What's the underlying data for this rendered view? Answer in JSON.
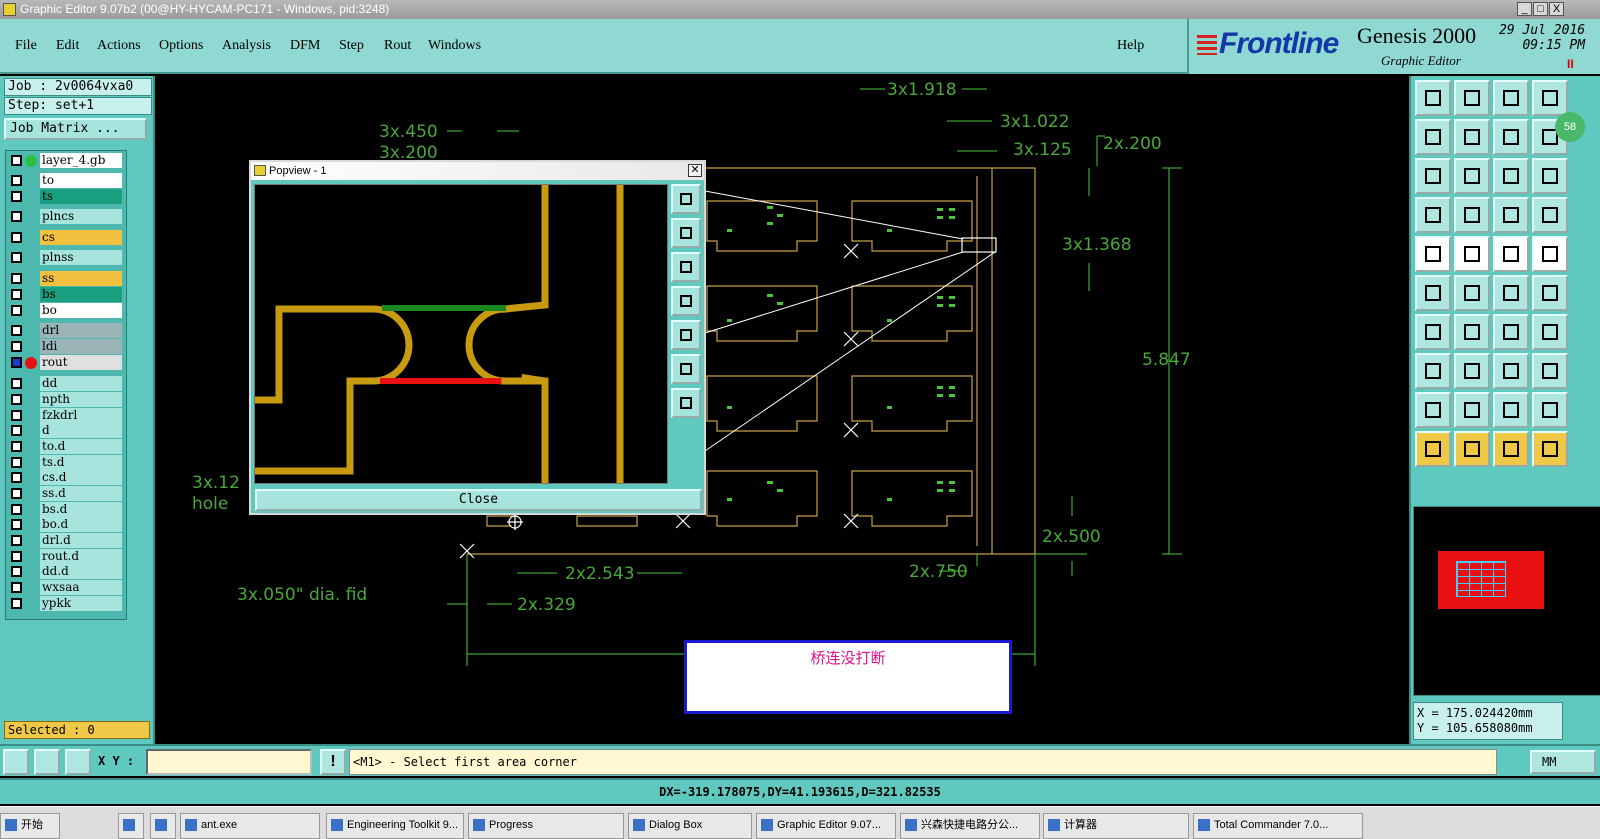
{
  "window": {
    "title": "Graphic Editor 9.07b2 (00@HY-HYCAM-PC171 - Windows, pid:3248)",
    "min": "_",
    "max": "□",
    "close": "X"
  },
  "menu": [
    "File",
    "Edit",
    "Actions",
    "Options",
    "Analysis",
    "DFM",
    "Step",
    "Rout",
    "Windows"
  ],
  "help": "Help",
  "logo": {
    "brand": "Frontline",
    "product": "Genesis 2000",
    "subtitle": "Graphic Editor",
    "date": "29 Jul 2016",
    "time": "09:15 PM",
    "pause": "II"
  },
  "job": {
    "job": "Job : 2v0064vxa0",
    "step": "Step: set+1",
    "matrix_button": "Job Matrix ..."
  },
  "layers": [
    {
      "name": "layer_4.gb",
      "color": "#ffffff",
      "dot": "#2cc040"
    },
    {
      "name": "to",
      "color": "#ffffff"
    },
    {
      "name": "ts",
      "color": "#1aa080"
    },
    {
      "name": "plncs",
      "color": "#a8e4de"
    },
    {
      "name": "cs",
      "color": "#f4c040"
    },
    {
      "name": "plnss",
      "color": "#a8e4de"
    },
    {
      "name": "ss",
      "color": "#f4c040"
    },
    {
      "name": "bs",
      "color": "#1aa080"
    },
    {
      "name": "bo",
      "color": "#ffffff"
    },
    {
      "name": "drl",
      "color": "#9ab4b8"
    },
    {
      "name": "ldi",
      "color": "#9ab4b8"
    },
    {
      "name": "rout",
      "color": "#e0e0e0",
      "dot": "#e81010",
      "active": true
    },
    {
      "name": "dd",
      "color": "#a8e4de"
    },
    {
      "name": "npth",
      "color": "#a8e4de"
    },
    {
      "name": "fzkdrl",
      "color": "#a8e4de"
    },
    {
      "name": "d",
      "color": "#a8e4de"
    },
    {
      "name": "to.d",
      "color": "#a8e4de"
    },
    {
      "name": "ts.d",
      "color": "#a8e4de"
    },
    {
      "name": "cs.d",
      "color": "#a8e4de"
    },
    {
      "name": "ss.d",
      "color": "#a8e4de"
    },
    {
      "name": "bs.d",
      "color": "#a8e4de"
    },
    {
      "name": "bo.d",
      "color": "#a8e4de"
    },
    {
      "name": "drl.d",
      "color": "#a8e4de"
    },
    {
      "name": "rout.d",
      "color": "#a8e4de"
    },
    {
      "name": "dd.d",
      "color": "#a8e4de"
    },
    {
      "name": "wxsaa",
      "color": "#a8e4de"
    },
    {
      "name": "ypkk",
      "color": "#a8e4de"
    }
  ],
  "selected": "Selected : 0",
  "dimensions": [
    "3x1.918",
    "3x.450",
    "3x.200",
    "3x1.022",
    "3x.125",
    "2x.200",
    "3x1.368",
    "5.847",
    "3x.12",
    "hole",
    "2x.500",
    "2x2.543",
    "2x.750",
    "3x.050\" dia. fid",
    "2x.329"
  ],
  "popview": {
    "title": "Popview - 1",
    "close_label": "Close"
  },
  "note": "桥连没打断",
  "coords": {
    "x": "X  =  175.024420mm",
    "y": "Y  =  105.658080mm"
  },
  "badge": "58",
  "bottom": {
    "xy_label": "X Y :",
    "xy_value": "",
    "excl": "!",
    "prompt": "<M1> - Select first area corner",
    "unit": "MM"
  },
  "status": "DX=-319.178075,DY=41.193615,D=321.82535",
  "taskbar": [
    "开始",
    "",
    "",
    "ant.exe",
    "Engineering Toolkit 9...",
    "Progress",
    "Dialog Box",
    "Graphic Editor 9.07...",
    "兴森快捷电路分公...",
    "计算器",
    "Total Commander 7.0..."
  ]
}
